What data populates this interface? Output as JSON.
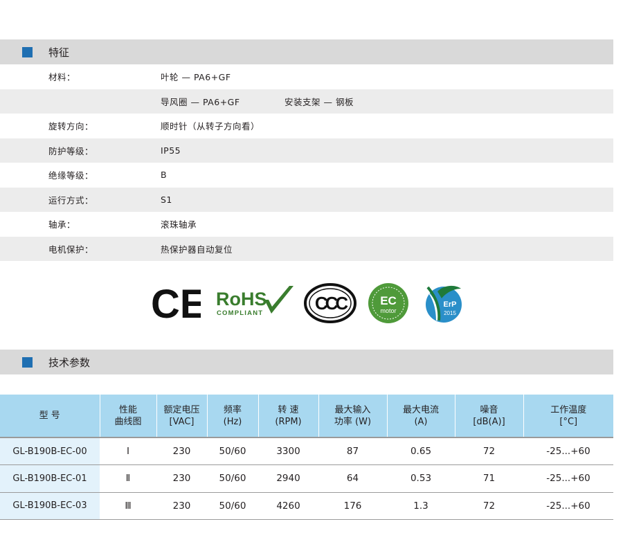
{
  "features_section": {
    "title": "特征"
  },
  "features": [
    {
      "label": "材料：",
      "value": "叶轮 — PA6+GF",
      "value2": ""
    },
    {
      "label": "",
      "value": "导风圈 — PA6+GF",
      "value2": "安装支架 — 钢板"
    },
    {
      "label": "旋转方向：",
      "value": "顺时针（从转子方向看）",
      "value2": ""
    },
    {
      "label": "防护等级：",
      "value": "IP55",
      "value2": ""
    },
    {
      "label": "绝缘等级：",
      "value": "B",
      "value2": ""
    },
    {
      "label": "运行方式：",
      "value": "S1",
      "value2": ""
    },
    {
      "label": "轴承：",
      "value": "滚珠轴承",
      "value2": ""
    },
    {
      "label": "电机保护：",
      "value": "热保护器自动复位",
      "value2": ""
    }
  ],
  "certifications": {
    "ce": "CE",
    "rohs": "RoHS",
    "rohs_sub": "COMPLIANT",
    "ccc": "CCC",
    "ec": "EC",
    "ec_sub": "motor",
    "erp": "ErP",
    "erp_year": "2015"
  },
  "specs_section": {
    "title": "技术参数"
  },
  "spec_table": {
    "headers": [
      [
        "型 号"
      ],
      [
        "性能",
        "曲线图"
      ],
      [
        "额定电压",
        "[VAC]"
      ],
      [
        "频率",
        "(Hz)"
      ],
      [
        "转 速",
        "(RPM)"
      ],
      [
        "最大输入",
        "功率 (W)"
      ],
      [
        "最大电流",
        "(A)"
      ],
      [
        "噪音",
        "[dB(A)]"
      ],
      [
        "工作温度",
        "[°C]"
      ]
    ],
    "rows": [
      [
        "GL-B190B-EC-00",
        "Ⅰ",
        "230",
        "50/60",
        "3300",
        "87",
        "0.65",
        "72",
        "-25...+60"
      ],
      [
        "GL-B190B-EC-01",
        "Ⅱ",
        "230",
        "50/60",
        "2940",
        "64",
        "0.53",
        "71",
        "-25...+60"
      ],
      [
        "GL-B190B-EC-03",
        "Ⅲ",
        "230",
        "50/60",
        "4260",
        "176",
        "1.3",
        "72",
        "-25...+60"
      ]
    ]
  },
  "colors": {
    "marker": "#1f6fb2",
    "header_bg": "#d9d9d9",
    "table_header_bg": "#a8d8f0",
    "rohs_green": "#3a7d2e",
    "ec_green": "#4f9a3a",
    "erp_blue": "#2a8fc9"
  }
}
